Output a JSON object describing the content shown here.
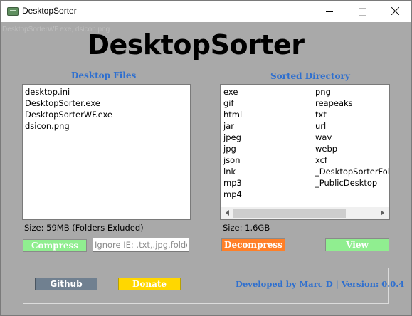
{
  "window": {
    "title": "DesktopSorter",
    "ghost_text": "DesktopSorterWF.exe, dsicon.png ...",
    "minimize_icon": "minimize-icon",
    "maximize_icon": "maximize-icon",
    "close_icon": "close-icon"
  },
  "header": {
    "heading": "DesktopSorter"
  },
  "desktop_files": {
    "label": "Desktop Files",
    "items": [
      "desktop.ini",
      "DesktopSorter.exe",
      "DesktopSorterWF.exe",
      "dsicon.png"
    ],
    "size": "Size: 59MB (Folders Exluded)"
  },
  "sorted_directory": {
    "label": "Sorted Directory",
    "column1": [
      "exe",
      "gif",
      "html",
      "jar",
      "jpeg",
      "jpg",
      "json",
      "lnk",
      "mp3",
      "mp4"
    ],
    "column2": [
      "png",
      "reapeaks",
      "txt",
      "url",
      "wav",
      "webp",
      "xcf",
      "_DesktopSorterFold",
      "_PublicDesktop"
    ],
    "size": "Size: 1.6GB"
  },
  "actions": {
    "compress_label": "Compress",
    "ignore_placeholder": "Ignore IE: .txt,.jpg,folders",
    "decompress_label": "Decompress",
    "view_label": "View"
  },
  "footer": {
    "github_label": "Github",
    "donate_label": "Donate",
    "credits": "Developed by Marc D | Version: 0.0.4"
  },
  "colors": {
    "accent_blue": "#2e6fcf",
    "compress_green": "#90ee90",
    "decompress_orange": "#ff7f27",
    "github_slate": "#708090",
    "donate_gold": "#ffd700",
    "client_gray": "#a9a9a9"
  }
}
